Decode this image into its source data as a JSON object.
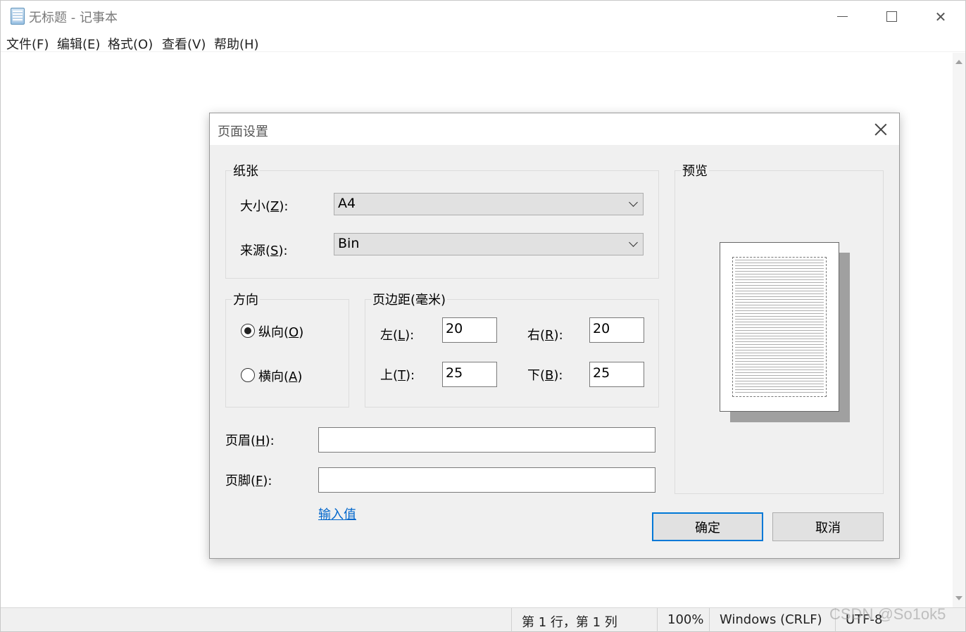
{
  "window": {
    "title": "无标题 - 记事本",
    "controls": {
      "minimize": "—",
      "maximize": "☐",
      "close": "✕"
    }
  },
  "menu": [
    "文件(F)",
    "编辑(E)",
    "格式(O)",
    "查看(V)",
    "帮助(H)"
  ],
  "status": {
    "position": "第 1 行，第 1 列",
    "zoom": "100%",
    "line_ending": "Windows (CRLF)",
    "encoding": "UTF-8"
  },
  "watermark": "CSDN @So1ok5",
  "dialog": {
    "title": "页面设置",
    "paper": {
      "group_label": "纸张",
      "size_label_prefix": "大小(",
      "size_label_key": "Z",
      "size_label_suffix": "):",
      "size_value": "A4",
      "source_label_prefix": "来源(",
      "source_label_key": "S",
      "source_label_suffix": "):",
      "source_value": "Bin"
    },
    "orientation": {
      "group_label": "方向",
      "portrait_prefix": "纵向(",
      "portrait_key": "O",
      "portrait_suffix": ")",
      "landscape_prefix": "横向(",
      "landscape_key": "A",
      "landscape_suffix": ")",
      "selected": "portrait"
    },
    "margins": {
      "group_label": "页边距(毫米)",
      "left_prefix": "左(",
      "left_key": "L",
      "left_suffix": "):",
      "left_value": "20",
      "right_prefix": "右(",
      "right_key": "R",
      "right_suffix": "):",
      "right_value": "20",
      "top_prefix": "上(",
      "top_key": "T",
      "top_suffix": "):",
      "top_value": "25",
      "bottom_prefix": "下(",
      "bottom_key": "B",
      "bottom_suffix": "):",
      "bottom_value": "25"
    },
    "header_prefix": "页眉(",
    "header_key": "H",
    "header_suffix": "):",
    "header_value": "",
    "footer_prefix": "页脚(",
    "footer_key": "F",
    "footer_suffix": "):",
    "footer_value": "",
    "input_values_link": "输入值",
    "preview_label": "预览",
    "ok_button": "确定",
    "cancel_button": "取消"
  }
}
